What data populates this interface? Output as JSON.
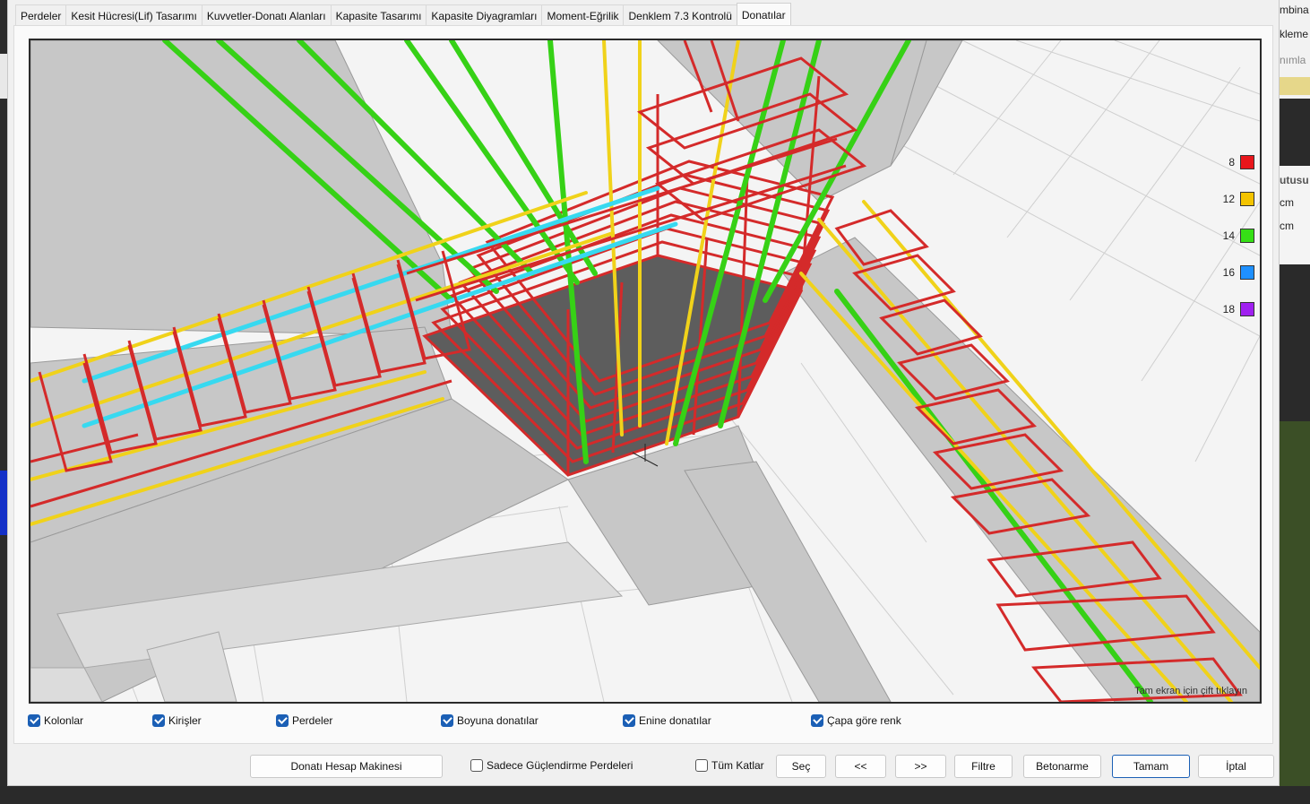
{
  "tabs": [
    {
      "label": "Perdeler"
    },
    {
      "label": "Kesit Hücresi(Lif) Tasarımı"
    },
    {
      "label": "Kuvvetler-Donatı Alanları"
    },
    {
      "label": "Kapasite Tasarımı"
    },
    {
      "label": "Kapasite Diyagramları"
    },
    {
      "label": "Moment-Eğrilik"
    },
    {
      "label": "Denklem 7.3 Kontrolü"
    },
    {
      "label": "Donatılar",
      "active": true
    }
  ],
  "legend": [
    {
      "label": "8",
      "color": "#e8161b"
    },
    {
      "label": "12",
      "color": "#f4c400"
    },
    {
      "label": "14",
      "color": "#36e016"
    },
    {
      "label": "16",
      "color": "#1e90ff"
    },
    {
      "label": "18",
      "color": "#a020f0"
    }
  ],
  "viewport": {
    "hint": "Tam ekran için çift tıklayın"
  },
  "checkboxes": [
    {
      "label": "Kolonlar",
      "checked": true
    },
    {
      "label": "Kirişler",
      "checked": true
    },
    {
      "label": "Perdeler",
      "checked": true
    },
    {
      "label": "Boyuna donatılar",
      "checked": true
    },
    {
      "label": "Enine donatılar",
      "checked": true
    },
    {
      "label": "Çapa göre renk",
      "checked": true
    }
  ],
  "bottom": {
    "calc_button": "Donatı Hesap Makinesi",
    "only_strengthening": "Sadece Güçlendirme Perdeleri",
    "all_floors": "Tüm Katlar",
    "select": "Seç",
    "prev": "<<",
    "next": ">>",
    "filter": "Filtre",
    "concrete": "Betonarme",
    "ok": "Tamam",
    "cancel": "İptal"
  },
  "background": {
    "right_texts": [
      "mbina",
      "kleme",
      "nımla",
      "utusu",
      "cm",
      "cm"
    ]
  }
}
